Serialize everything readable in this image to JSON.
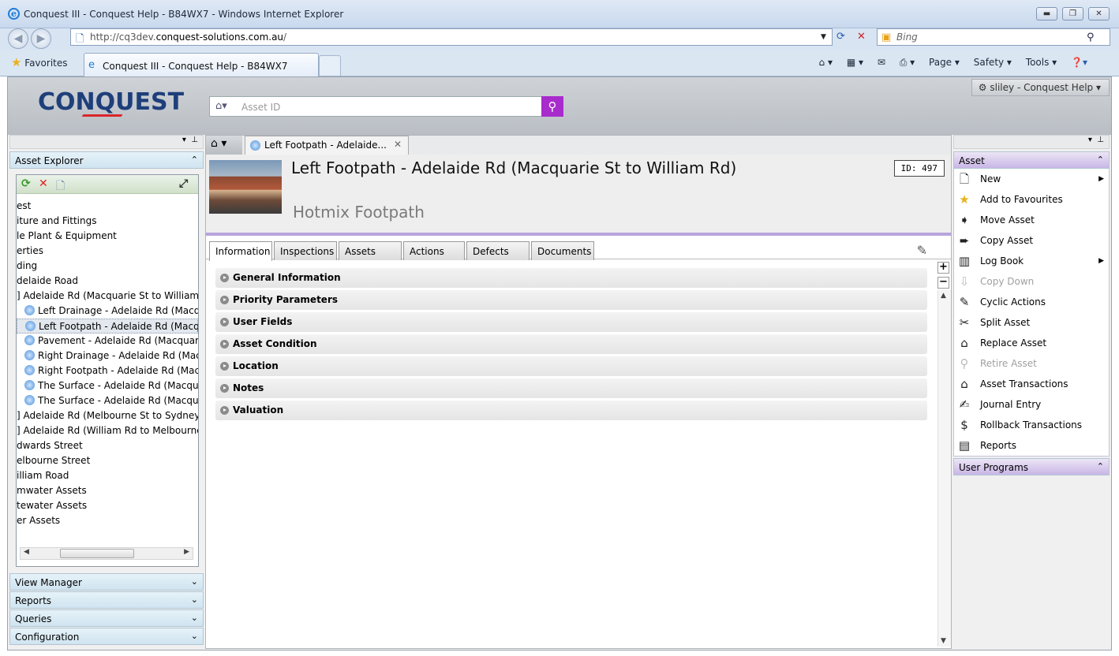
{
  "browser": {
    "window_title": "Conquest III - Conquest Help - B84WX7 - Windows Internet Explorer",
    "url_prefix": "http://cq3dev.",
    "url_domain": "conquest-solutions.com.au",
    "url_suffix": "/",
    "search_placeholder": "Bing",
    "favorites_label": "Favorites",
    "tab_title": "Conquest III - Conquest Help - B84WX7",
    "cmd": {
      "page": "Page ▾",
      "safety": "Safety ▾",
      "tools": "Tools ▾"
    }
  },
  "app": {
    "logo_text": "CONQUEST",
    "search_placeholder": "Asset ID",
    "user_menu": "sliley - Conquest Help ▾"
  },
  "left_panel": {
    "asset_explorer_label": "Asset Explorer",
    "tree_items": [
      {
        "label": "est",
        "icon": false
      },
      {
        "label": "iture and Fittings",
        "icon": false
      },
      {
        "label": "le Plant & Equipment",
        "icon": false
      },
      {
        "label": "erties",
        "icon": false
      },
      {
        "label": "ding",
        "icon": false
      },
      {
        "label": "delaide Road",
        "icon": false
      },
      {
        "label": "] Adelaide Rd (Macquarie St to William F",
        "icon": false
      },
      {
        "label": "Left Drainage - Adelaide Rd (Macqu",
        "icon": true
      },
      {
        "label": "Left Footpath - Adelaide Rd (Macqu",
        "icon": true,
        "selected": true
      },
      {
        "label": "Pavement - Adelaide Rd (Macquarie",
        "icon": true
      },
      {
        "label": "Right Drainage - Adelaide Rd (Macq",
        "icon": true
      },
      {
        "label": "Right Footpath - Adelaide Rd (Macq",
        "icon": true
      },
      {
        "label": "The Surface - Adelaide Rd (Macquai",
        "icon": true
      },
      {
        "label": "The Surface - Adelaide Rd (Macquai",
        "icon": true
      },
      {
        "label": "] Adelaide Rd (Melbourne St to Sydney",
        "icon": false
      },
      {
        "label": "] Adelaide Rd (William Rd to Melbourne",
        "icon": false
      },
      {
        "label": "dwards Street",
        "icon": false
      },
      {
        "label": "elbourne Street",
        "icon": false
      },
      {
        "label": "illiam Road",
        "icon": false
      },
      {
        "label": "mwater Assets",
        "icon": false
      },
      {
        "label": "tewater Assets",
        "icon": false
      },
      {
        "label": "er Assets",
        "icon": false
      }
    ],
    "bottom_panels": [
      "View Manager",
      "Reports",
      "Queries",
      "Configuration"
    ]
  },
  "center": {
    "tab_label": "Left Footpath - Adelaide...",
    "asset_title": "Left Footpath - Adelaide Rd (Macquarie St to William Rd)",
    "asset_subtitle": "Hotmix Footpath",
    "asset_id_text": "ID:  497",
    "info_tabs": [
      "Information",
      "Inspections",
      "Assets",
      "Actions",
      "Defects",
      "Documents"
    ],
    "sections": [
      "General Information",
      "Priority Parameters",
      "User Fields",
      "Asset Condition",
      "Location",
      "Notes",
      "Valuation"
    ]
  },
  "right_panel": {
    "asset_header": "Asset",
    "user_programs_header": "User Programs",
    "actions": [
      {
        "label": "New",
        "icon": "new-document-icon",
        "glyph": "🗋",
        "submenu": true,
        "enabled": true
      },
      {
        "label": "Add to Favourites",
        "icon": "star-icon",
        "glyph": "★",
        "submenu": false,
        "enabled": true
      },
      {
        "label": "Move Asset",
        "icon": "move-arrow-icon",
        "glyph": "➧",
        "submenu": false,
        "enabled": true
      },
      {
        "label": "Copy Asset",
        "icon": "copy-arrow-icon",
        "glyph": "➨",
        "submenu": false,
        "enabled": true
      },
      {
        "label": "Log Book",
        "icon": "books-icon",
        "glyph": "▥",
        "submenu": true,
        "enabled": true
      },
      {
        "label": "Copy Down",
        "icon": "copy-down-icon",
        "glyph": "⇩",
        "submenu": false,
        "enabled": false
      },
      {
        "label": "Cyclic Actions",
        "icon": "wrench-icon",
        "glyph": "✎",
        "submenu": false,
        "enabled": true
      },
      {
        "label": "Split Asset",
        "icon": "split-icon",
        "glyph": "✂",
        "submenu": false,
        "enabled": true
      },
      {
        "label": "Replace Asset",
        "icon": "replace-house-icon",
        "glyph": "⌂",
        "submenu": false,
        "enabled": true
      },
      {
        "label": "Retire Asset",
        "icon": "retire-icon",
        "glyph": "⚲",
        "submenu": false,
        "enabled": false
      },
      {
        "label": "Asset Transactions",
        "icon": "transactions-house-icon",
        "glyph": "⌂",
        "submenu": false,
        "enabled": true
      },
      {
        "label": "Journal Entry",
        "icon": "journal-icon",
        "glyph": "✍",
        "submenu": false,
        "enabled": true
      },
      {
        "label": "Rollback Transactions",
        "icon": "rollback-dollar-icon",
        "glyph": "$",
        "submenu": false,
        "enabled": true
      },
      {
        "label": "Reports",
        "icon": "reports-icon",
        "glyph": "▤",
        "submenu": false,
        "enabled": true
      }
    ]
  },
  "colors": {
    "accent_purple": "#a82bcc",
    "header_purple": "#b7a4dd",
    "logo_blue": "#1e3f7a",
    "logo_red": "#d9262b"
  }
}
